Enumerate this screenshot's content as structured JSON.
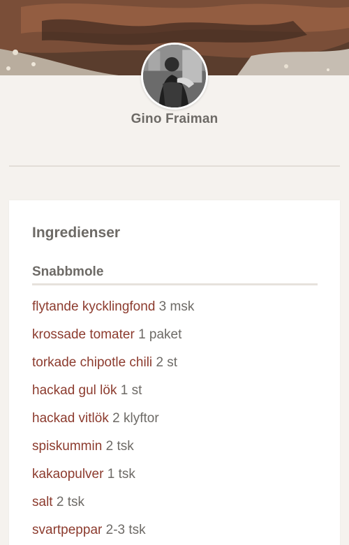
{
  "author": {
    "name": "Gino Fraiman"
  },
  "ingredients": {
    "title": "Ingredienser",
    "groups": [
      {
        "title": "Snabbmole",
        "items": [
          {
            "name": "flytande kycklingfond",
            "qty": "3 msk"
          },
          {
            "name": "krossade tomater",
            "qty": "1 paket"
          },
          {
            "name": "torkade chipotle chili",
            "qty": "2 st"
          },
          {
            "name": "hackad gul lök",
            "qty": "1 st"
          },
          {
            "name": "hackad vitlök",
            "qty": "2 klyftor"
          },
          {
            "name": "spiskummin",
            "qty": "2 tsk"
          },
          {
            "name": "kakaopulver",
            "qty": "1 tsk"
          },
          {
            "name": "salt",
            "qty": "2 tsk"
          },
          {
            "name": "svartpeppar",
            "qty": "2-3 tsk"
          }
        ]
      }
    ]
  },
  "colors": {
    "background": "#f5f2ee",
    "ingredient_link": "#8c3b2e",
    "text_muted": "#6d6a66",
    "card": "#ffffff"
  }
}
